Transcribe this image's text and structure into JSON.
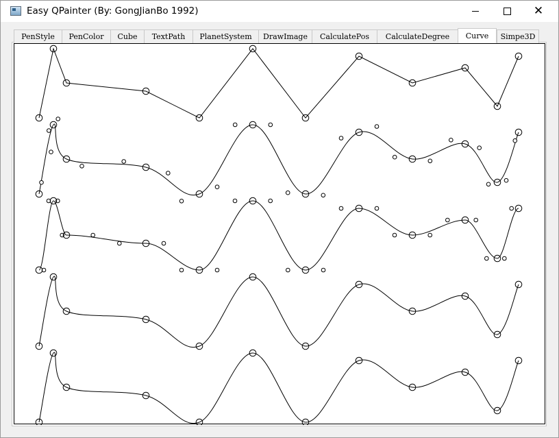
{
  "window": {
    "title": "Easy QPainter (By: GongJianBo 1992)",
    "icon": "app-window-icon",
    "controls": {
      "minimize": "minimize-icon",
      "maximize": "maximize-icon",
      "close": "close-icon"
    }
  },
  "tabs": [
    {
      "label": "PenStyle",
      "active": false
    },
    {
      "label": "PenColor",
      "active": false
    },
    {
      "label": "Cube",
      "active": false
    },
    {
      "label": "TextPath",
      "active": false
    },
    {
      "label": "PlanetSystem",
      "active": false
    },
    {
      "label": "DrawImage",
      "active": false
    },
    {
      "label": "CalculatePos",
      "active": false
    },
    {
      "label": "CalculateDegree",
      "active": false
    },
    {
      "label": "Curve",
      "active": true
    },
    {
      "label": "Simpe3D",
      "active": false
    }
  ],
  "curve_demo": {
    "stroke_color": "#000000",
    "point_x": [
      56,
      77,
      96,
      212,
      290,
      368,
      445,
      523,
      601,
      678,
      725,
      756
    ],
    "point_y": [
      105,
      4,
      54,
      66,
      105,
      4,
      105,
      15,
      54,
      32,
      88,
      15
    ],
    "row_offsets": [
      0,
      111,
      222,
      333,
      444
    ],
    "rows": [
      {
        "style": "polyline",
        "control_points": false
      },
      {
        "style": "catmull",
        "control_points": true,
        "control_mode": "horizontal"
      },
      {
        "style": "catmull",
        "control_points": true,
        "control_mode": "vertical-flat"
      },
      {
        "style": "catmull",
        "control_points": false
      },
      {
        "style": "catmull",
        "control_points": false
      }
    ]
  }
}
